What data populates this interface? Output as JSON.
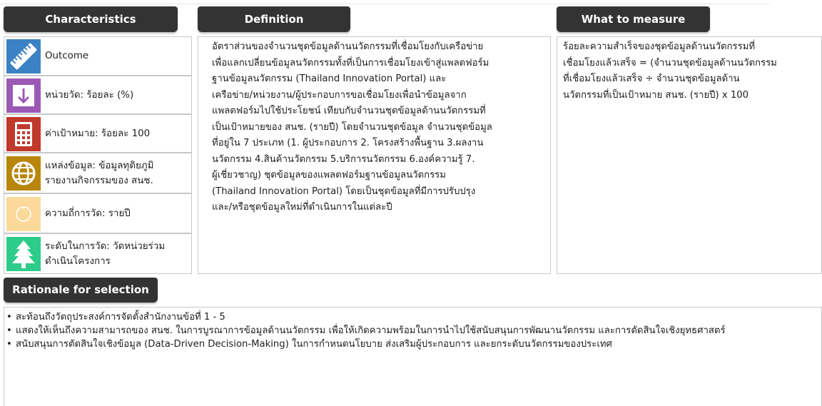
{
  "headers": {
    "characteristics": "Characteristics",
    "definition": "Definition",
    "what_to_measure": "What to measure",
    "rationale": "Rationale for selection"
  },
  "characteristics": [
    {
      "icon": "ruler-icon",
      "color": "#3b82c4",
      "label": "Outcome"
    },
    {
      "icon": "arrow-down-icon",
      "color": "#9b59b6",
      "label": "หน่วยวัด: ร้อยละ (%)"
    },
    {
      "icon": "calculator-icon",
      "color": "#c0392b",
      "label": "ค่าเป้าหมาย: ร้อยละ 100"
    },
    {
      "icon": "globe-icon",
      "color": "#b8860b",
      "label": "แหล่งข้อมูล: ข้อมูลทุติยภูมิ รายงานกิจกรรมของ สนช."
    },
    {
      "icon": "clock-icon",
      "color": "#fbd99a",
      "label": "ความถี่การวัด: รายปี"
    },
    {
      "icon": "tree-icon",
      "color": "#2ecc8a",
      "label": "ระดับในการวัด: วัดหน่วยร่วมดำเนินโครงการ"
    }
  ],
  "definition": {
    "lines": [
      "อัตราส่วนของจำนวนชุดข้อมูลด้านนวัตกรรมที่เชื่อมโยงกับเครือข่าย",
      "เพื่อแลกเปลี่ยนข้อมูลนวัตกรรมทั้งที่เป็นการเชื่อมโยงเข้าสู่แพลตฟอร์ม",
      "ฐานข้อมูลนวัตกรรม (Thailand Innovation Portal) และ",
      "เครือข่าย/หน่วยงาน/ผู้ประกอบการขอเชื่อมโยงเพื่อนำข้อมูลจาก",
      "แพลตฟอร์มไปใช้ประโยชน์ เทียบกับจำนวนชุดข้อมูลด้านนวัตกรรมที่",
      "เป็นเป้าหมายของ สนช. (รายปี) โดยจำนวนชุดข้อมูล จำนวนชุดข้อมูล",
      "ที่อยู่ใน 7 ประเภท (1. ผู้ประกอบการ 2. โครงสร้างพื้นฐาน 3.ผลงาน",
      "นวัตกรรม 4.สินค้านวัตกรรม 5.บริการนวัตกรรม 6.องค์ความรู้ 7.",
      "ผู้เชี่ยวชาญ) ชุดข้อมูลของแพลตฟอร์มฐานข้อมูลนวัตกรรม",
      "(Thailand Innovation Portal) โดยเป็นชุดข้อมูลที่มีการปรับปรุง",
      "และ/หรือชุดข้อมูลใหม่ที่ดำเนินการในแต่ละปี"
    ]
  },
  "what_to_measure": {
    "lines": [
      "ร้อยละความสำเร็จของชุดข้อมูลด้านนวัตกรรมที่",
      "เชื่อมโยงแล้วเสร็จ = (จำนวนชุดข้อมูลด้านนวัตกรรม",
      "ที่เชื่อมโยงแล้วเสร็จ ÷ จำนวนชุดข้อมูลด้าน",
      "นวัตกรรมที่เป็นเป้าหมาย สนช. (รายปี) x 100"
    ]
  },
  "rationale": {
    "items": [
      "สะท้อนถึงวัตถุประสงค์การจัดตั้งสำนักงานข้อที่ 1 - 5",
      "แสดงให้เห็นถึงความสามารถของ สนช. ในการบูรณาการข้อมูลด้านนวัตกรรม เพื่อให้เกิดความพร้อมในการนำไปใช้สนับสนุนการพัฒนานวัตกรรม และการตัดสินใจเชิงยุทธศาสตร์",
      "สนับสนุนการตัดสินใจเชิงข้อมูล (Data-Driven Decision-Making) ในการกำหนดนโยบาย ส่งเสริมผู้ประกอบการ และยกระดับนวัตกรรมของประเทศ"
    ]
  }
}
